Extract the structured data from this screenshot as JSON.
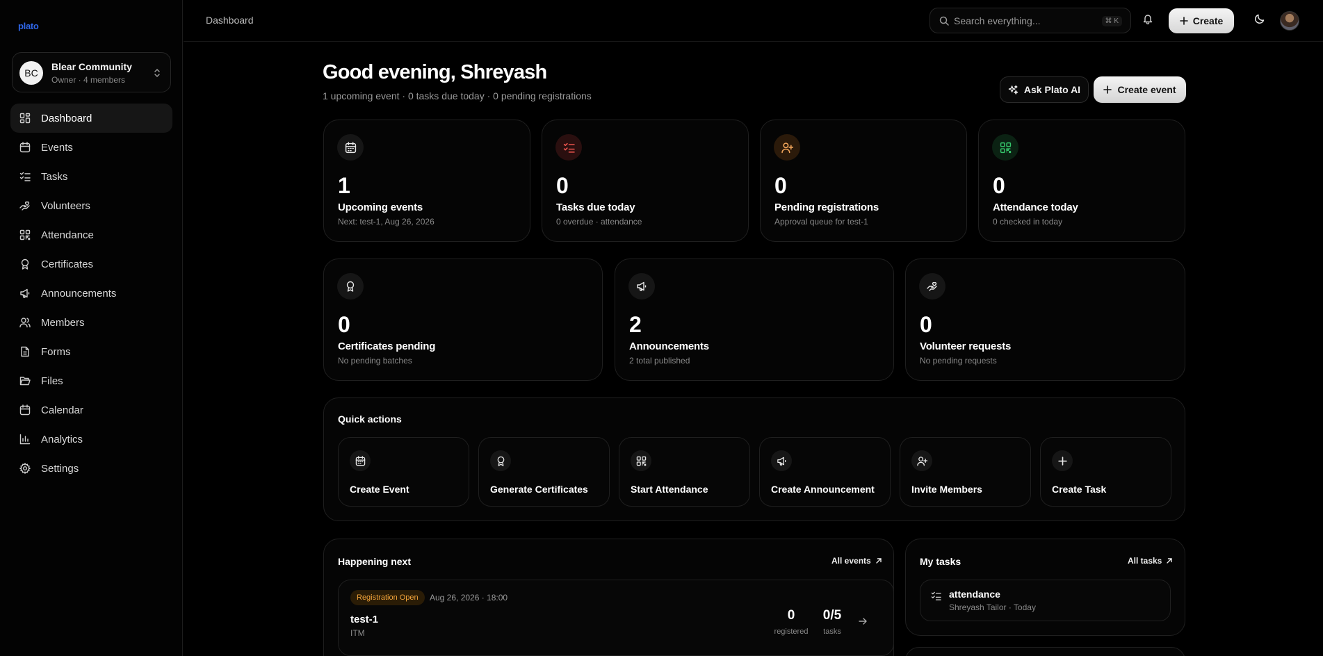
{
  "app": {
    "logo": "plato",
    "breadcrumb": "Dashboard"
  },
  "org": {
    "initials": "BC",
    "name": "Blear Community",
    "subtitle": "Owner · 4 members"
  },
  "sidebar": {
    "items": [
      {
        "label": "Dashboard",
        "icon": "layout-dashboard-icon",
        "active": true
      },
      {
        "label": "Events",
        "icon": "calendar-icon"
      },
      {
        "label": "Tasks",
        "icon": "list-checks-icon"
      },
      {
        "label": "Volunteers",
        "icon": "hand-heart-icon"
      },
      {
        "label": "Attendance",
        "icon": "qr-code-icon"
      },
      {
        "label": "Certificates",
        "icon": "award-icon"
      },
      {
        "label": "Announcements",
        "icon": "megaphone-icon"
      },
      {
        "label": "Members",
        "icon": "users-icon"
      },
      {
        "label": "Forms",
        "icon": "file-text-icon"
      },
      {
        "label": "Files",
        "icon": "folder-open-icon"
      },
      {
        "label": "Calendar",
        "icon": "calendar-days-icon"
      },
      {
        "label": "Analytics",
        "icon": "bar-chart-icon"
      },
      {
        "label": "Settings",
        "icon": "gear-icon"
      }
    ]
  },
  "topbar": {
    "search_placeholder": "Search everything...",
    "search_shortcut": "⌘ K",
    "create_label": "Create"
  },
  "header": {
    "greeting": "Good evening, Shreyash",
    "summary": "1 upcoming event · 0 tasks due today · 0 pending registrations",
    "ask_label": "Ask Plato AI",
    "create_event_label": "Create event"
  },
  "stats_top": [
    {
      "value": "1",
      "label": "Upcoming events",
      "sub": "Next: test-1, Aug 26, 2026",
      "icon": "calendar-icon",
      "icon_color": "#e8e8e8",
      "icon_bg": "#161616"
    },
    {
      "value": "0",
      "label": "Tasks due today",
      "sub": "0 overdue · attendance",
      "icon": "list-checks-icon",
      "icon_color": "#f0554f",
      "icon_bg": "#2a0f0f"
    },
    {
      "value": "0",
      "label": "Pending registrations",
      "sub": "Approval queue for test-1",
      "icon": "user-plus-icon",
      "icon_color": "#f0a45a",
      "icon_bg": "#2b1a0a"
    },
    {
      "value": "0",
      "label": "Attendance today",
      "sub": "0 checked in today",
      "icon": "qr-code-icon",
      "icon_color": "#35c46a",
      "icon_bg": "#0b2213"
    }
  ],
  "stats_bottom": [
    {
      "value": "0",
      "label": "Certificates pending",
      "sub": "No pending batches",
      "icon": "award-icon"
    },
    {
      "value": "2",
      "label": "Announcements",
      "sub": "2 total published",
      "icon": "megaphone-icon"
    },
    {
      "value": "0",
      "label": "Volunteer requests",
      "sub": "No pending requests",
      "icon": "hand-heart-icon"
    }
  ],
  "quick_actions": {
    "title": "Quick actions",
    "items": [
      {
        "label": "Create Event",
        "icon": "calendar-icon"
      },
      {
        "label": "Generate Certificates",
        "icon": "award-icon"
      },
      {
        "label": "Start Attendance",
        "icon": "qr-code-icon"
      },
      {
        "label": "Create Announcement",
        "icon": "megaphone-icon"
      },
      {
        "label": "Invite Members",
        "icon": "user-plus-icon"
      },
      {
        "label": "Create Task",
        "icon": "plus-icon"
      }
    ]
  },
  "happening": {
    "title": "Happening next",
    "link": "All events",
    "event": {
      "badge": "Registration Open",
      "date": "Aug 26, 2026 · 18:00",
      "name": "test-1",
      "location": "ITM",
      "registered_value": "0",
      "registered_label": "registered",
      "tasks_value": "0/5",
      "tasks_label": "tasks"
    }
  },
  "my_tasks": {
    "title": "My tasks",
    "link": "All tasks",
    "task": {
      "name": "attendance",
      "sub": "Shreyash Tailor · Today"
    }
  }
}
